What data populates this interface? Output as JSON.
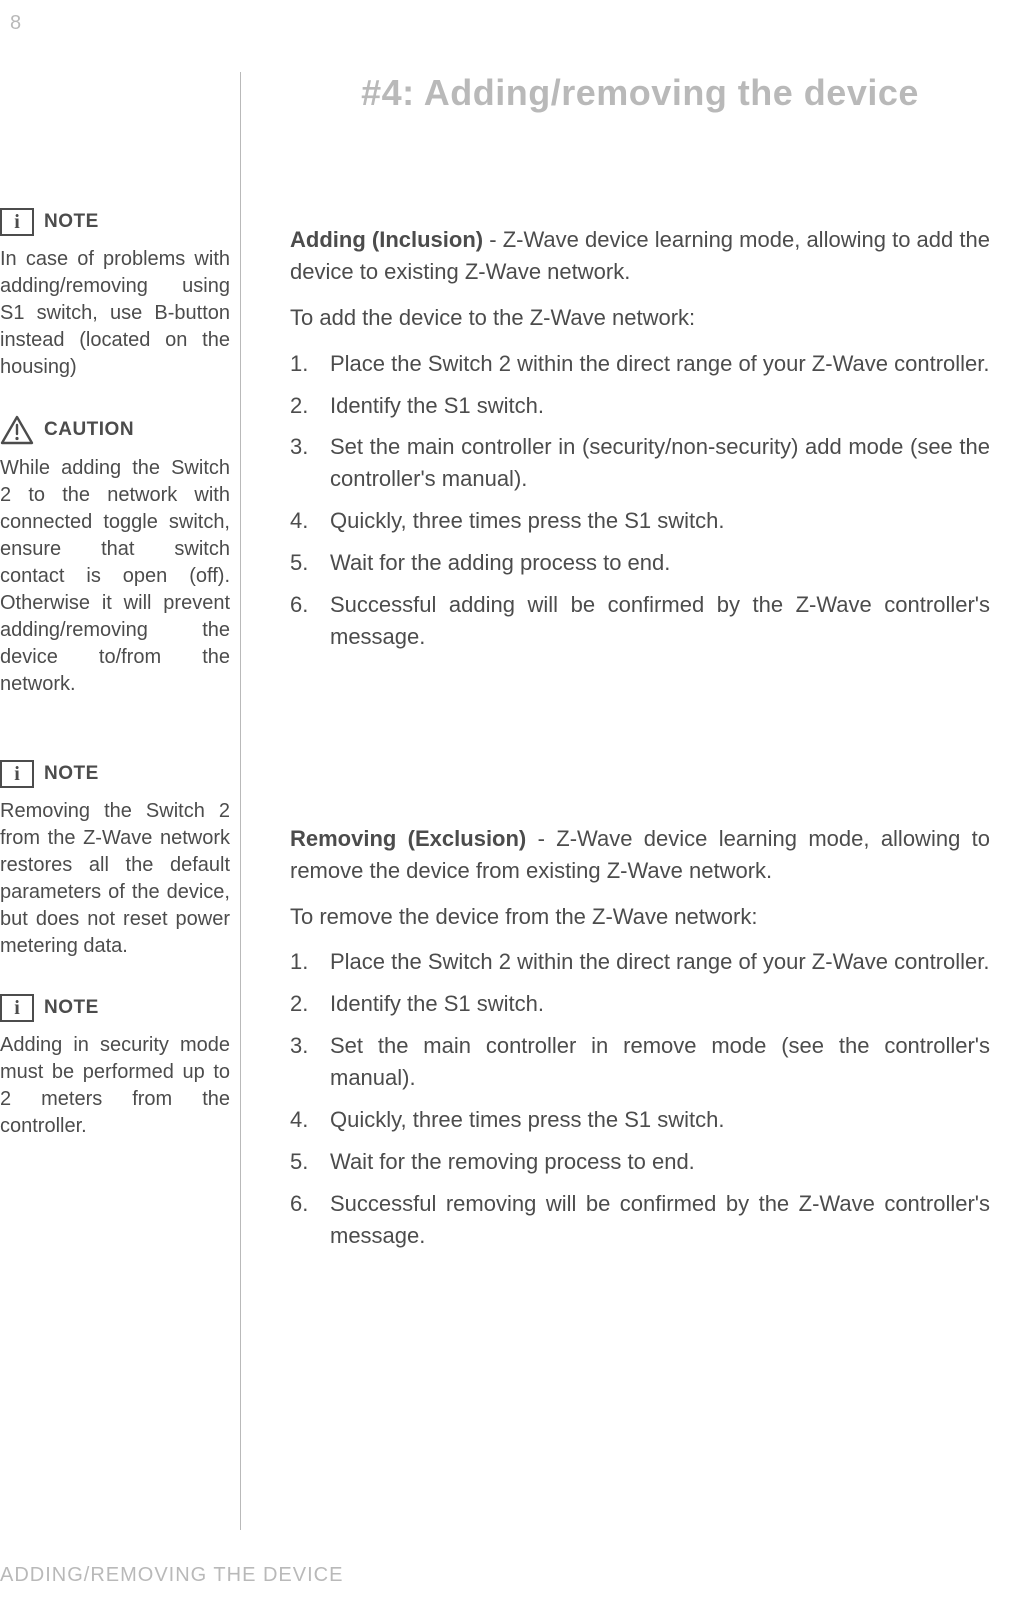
{
  "page_number": "8",
  "section_title": "#4: Adding/removing the device",
  "sidebar": {
    "note1": {
      "label": "NOTE",
      "text": "In case of problems with adding/remov­ing using S1 switch, use B-button instead (located on the hous­ing)"
    },
    "caution": {
      "label": "CAUTION",
      "text": "While adding the Switch 2 to the net­work with connected toggle switch, ensure that switch contact is open (off). Otherwise it will prevent adding/removing the device to/from the network."
    },
    "note2": {
      "label": "NOTE",
      "text": "Removing the Switch 2 from the Z-Wave net­work restores all the default parameters of the device, but does not reset power me­tering data."
    },
    "note3": {
      "label": "NOTE",
      "text": "Adding in security mode must be per­formed up to 2 meters from the controller."
    }
  },
  "main": {
    "adding": {
      "heading_bold": "Adding (Inclusion)",
      "heading_rest": " - Z-Wave device learning mode, allowing to add the device to existing Z-Wave network.",
      "intro": "To add the device to the Z-Wave network:",
      "steps": [
        "Place the Switch 2 within the direct range of your Z-Wave controller.",
        "Identify the S1 switch.",
        "Set the main controller in (security/non-security) add mode (see the controller's manual).",
        "Quickly, three times press the S1 switch.",
        "Wait for the adding process to end.",
        "Successful adding will be confirmed by the Z-Wave controller's message."
      ]
    },
    "removing": {
      "heading_bold": "Removing (Exclusion)",
      "heading_rest": " - Z-Wave device learning mode, allowing to remove the device from existing Z-Wave network.",
      "intro": "To remove the device from the Z-Wave network:",
      "steps": [
        "Place the Switch 2 within the direct range of your Z-Wave controller.",
        "Identify the S1 switch.",
        "Set the main controller in remove mode (see the controller's manual).",
        "Quickly, three times press the S1 switch.",
        "Wait for the removing process to end.",
        "Successful removing will be confirmed by the Z-Wave controller's message."
      ]
    }
  },
  "footer": "ADDING/REMOVING THE DEVICE"
}
